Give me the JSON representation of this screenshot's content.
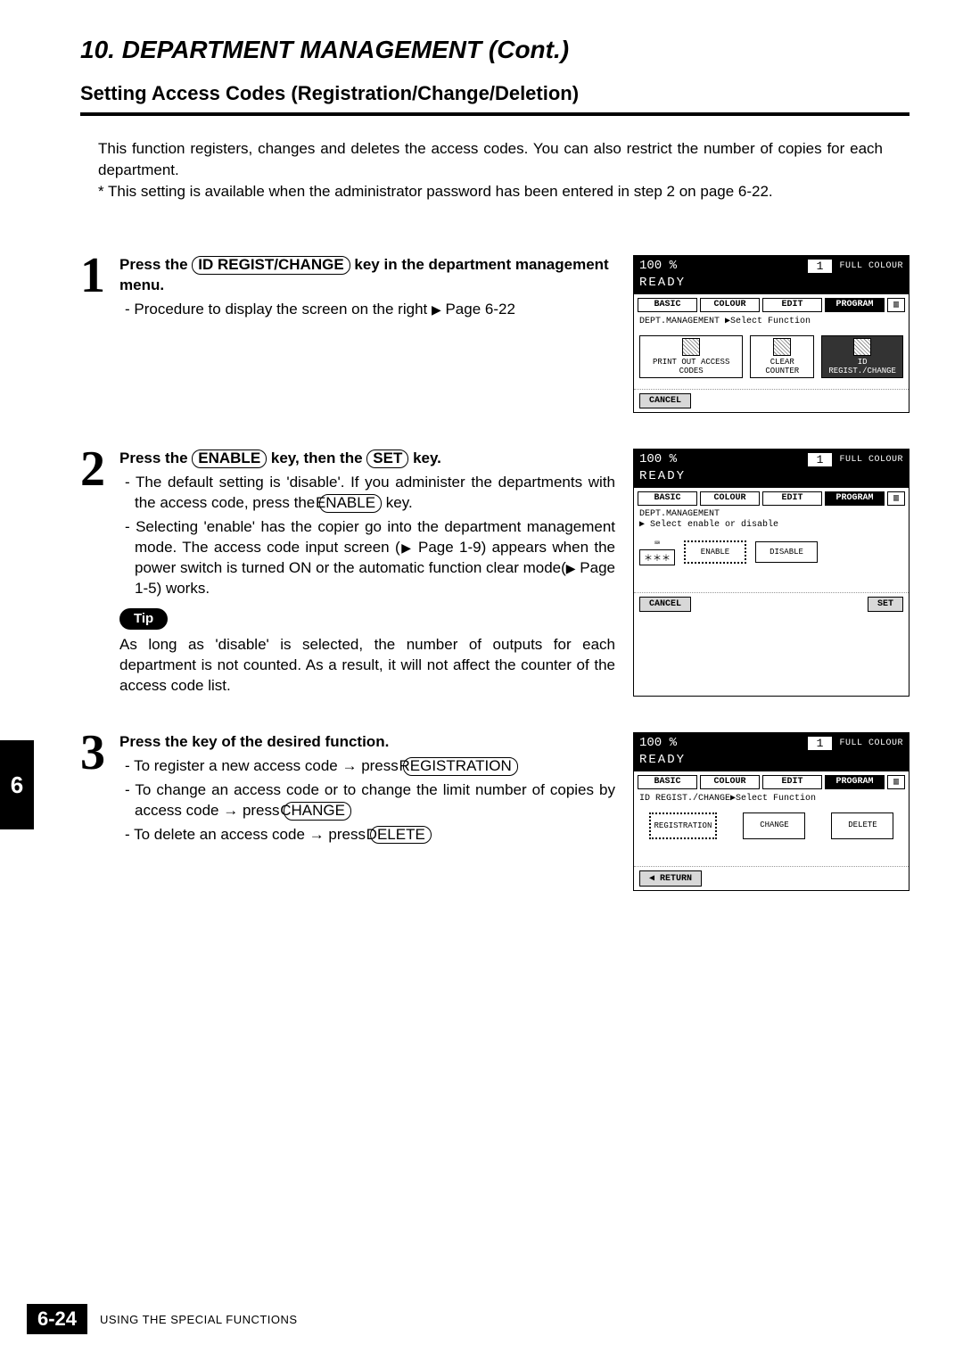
{
  "section_number": "10.",
  "section_title": "DEPARTMENT MANAGEMENT (Cont.)",
  "subtitle": "Setting Access Codes (Registration/Change/Deletion)",
  "intro_p1": "This function registers, changes and deletes the access codes.  You can also restrict the number of copies for each department.",
  "intro_p2": "* This setting is available when the administrator password has been entered in step 2 on page 6-22.",
  "side_tab": "6",
  "page_number": "6-24",
  "footer_text": "USING THE SPECIAL FUNCTIONS",
  "steps": {
    "s1": {
      "num": "1",
      "lead_a": "Press the ",
      "key": "ID REGIST/CHANGE",
      "lead_b": " key in the department management menu.",
      "b1a": "-  Procedure to display the screen on the right ",
      "b1b": " Page 6-22"
    },
    "s2": {
      "num": "2",
      "lead_a": "Press the ",
      "key1": "ENABLE",
      "lead_b": " key, then the",
      "key2": "SET",
      "lead_c": " key.",
      "b1a": "- The default setting is 'disable'.  If you administer the departments with the access code, press the ",
      "b1k": "ENABLE",
      "b1b": " key.",
      "b2a": "- Selecting  'enable' has the copier go into the department management mode.  The access code input screen (",
      "b2b": " Page 1-9) appears when the power switch is turned ON or the automatic function clear mode(",
      "b2c": " Page 1-5) works.",
      "tip_label": "Tip",
      "tip_text": "As long as 'disable' is selected, the number of outputs for each department is not counted.  As a result, it will not affect the counter of the access code list."
    },
    "s3": {
      "num": "3",
      "lead": "Press the  key of the desired function.",
      "b1a": "- To register a new access code → press ",
      "b1k": "REGISTRATION",
      "b2a": "- To change an access code or to change the limit number of copies by access code → press ",
      "b2k": "CHANGE",
      "b3a": "- To delete an access code → press ",
      "b3k": "DELETE"
    }
  },
  "screens": {
    "common": {
      "pct": "100  %",
      "one": "1",
      "full_colour": "FULL COLOUR",
      "ready": "READY",
      "tabs": {
        "basic": "BASIC",
        "colour": "COLOUR",
        "edit": "EDIT",
        "program": "PROGRAM"
      }
    },
    "sc1": {
      "crumb": "DEPT.MANAGEMENT  ▶Select Function",
      "btn1": "PRINT OUT ACCESS CODES",
      "btn2": "CLEAR COUNTER",
      "btn3": "ID REGIST./CHANGE",
      "cancel": "CANCEL"
    },
    "sc2": {
      "crumb1": "DEPT.MANAGEMENT",
      "crumb2": "▶ Select enable or disable",
      "sym": "＊＊＊",
      "enable": "ENABLE",
      "disable": "DISABLE",
      "cancel": "CANCEL",
      "set": "SET"
    },
    "sc3": {
      "crumb": "ID REGIST./CHANGE▶Select Function",
      "reg": "REGISTRATION",
      "change": "CHANGE",
      "delete": "DELETE",
      "return": "RETURN"
    }
  }
}
